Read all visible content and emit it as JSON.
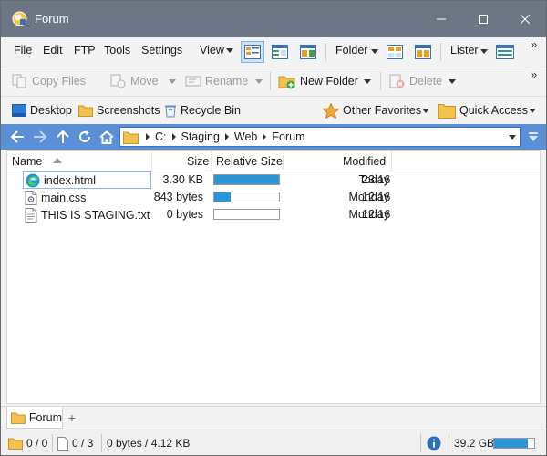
{
  "window": {
    "title": "Forum"
  },
  "menu": {
    "file": "File",
    "edit": "Edit",
    "ftp": "FTP",
    "tools": "Tools",
    "settings": "Settings",
    "view": "View",
    "folder": "Folder",
    "lister": "Lister",
    "overflow": "»"
  },
  "toolbar": {
    "copy_files": "Copy Files",
    "move": "Move",
    "rename": "Rename",
    "new_folder": "New Folder",
    "delete": "Delete",
    "overflow": "»"
  },
  "favorites": {
    "desktop": "Desktop",
    "screenshots": "Screenshots",
    "recycle_bin": "Recycle Bin",
    "other_favorites": "Other Favorites",
    "quick_access": "Quick Access"
  },
  "address": {
    "crumbs": [
      "C:",
      "Staging",
      "Web",
      "Forum"
    ]
  },
  "filelist": {
    "columns": {
      "name": "Name",
      "size": "Size",
      "relative_size": "Relative Size",
      "modified": "Modified"
    },
    "files": [
      {
        "name": "index.html",
        "size": "3.30 KB",
        "relative": 1.0,
        "day": "Today",
        "time": "23:16",
        "icon": "edge-icon"
      },
      {
        "name": "main.css",
        "size": "843 bytes",
        "relative": 0.25,
        "day": "Monday",
        "time": "12:16",
        "icon": "css-file-icon"
      },
      {
        "name": "THIS IS STAGING.txt",
        "size": "0 bytes",
        "relative": 0.0,
        "day": "Monday",
        "time": "12:16",
        "icon": "text-file-icon"
      }
    ]
  },
  "tabs": {
    "active": "Forum",
    "add": "+"
  },
  "status": {
    "folders": "0 / 0",
    "files": "0 / 3",
    "size": "0 bytes / 4.12 KB",
    "free_space": "39.2 GB",
    "disk_used": 0.85
  },
  "colors": {
    "titlebar": "#6c7684",
    "address": "#5b8fd6",
    "accent": "#2a96d8"
  }
}
